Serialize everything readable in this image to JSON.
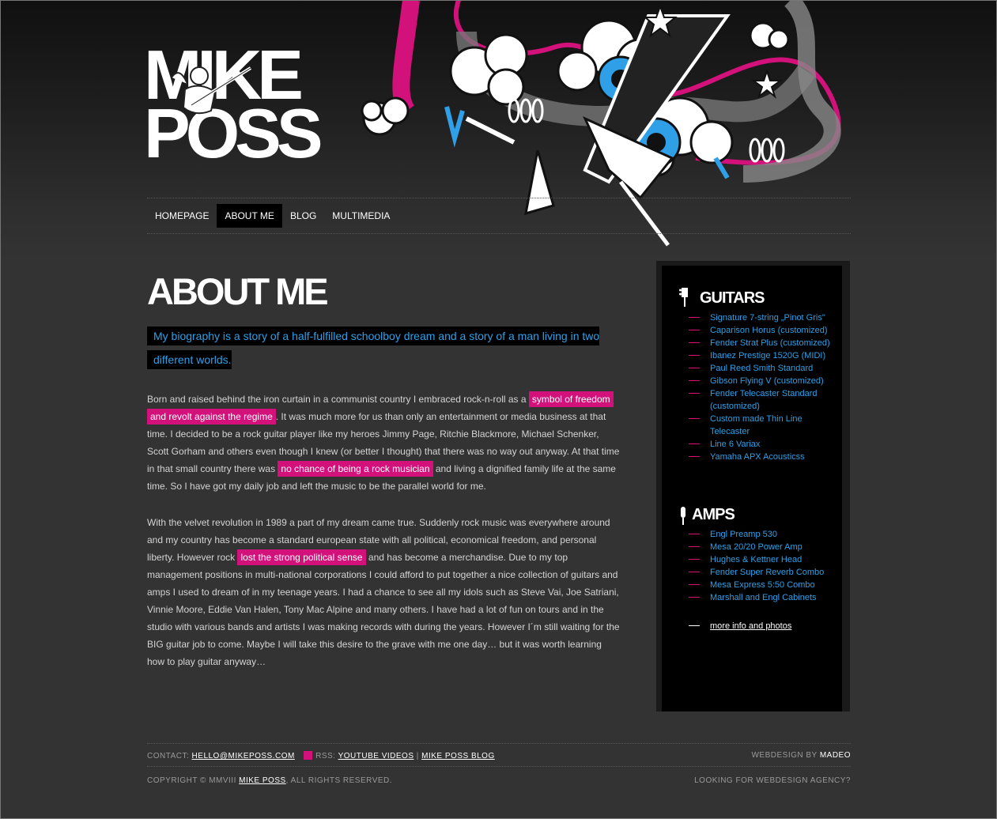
{
  "nav": {
    "items": [
      {
        "label": "HOMEPAGE"
      },
      {
        "label": "ABOUT ME"
      },
      {
        "label": "BLOG"
      },
      {
        "label": "MULTIMEDIA"
      }
    ]
  },
  "logo": {
    "line1": "MIKE",
    "line2": "POSS"
  },
  "main": {
    "title": "ABOUT ME",
    "intro": "My biography is a story of a half-fulfilled schoolboy dream and a story of a man living in two different worlds.",
    "p1": {
      "a": "Born and raised behind the iron curtain in a communist country I embraced rock-n-roll as a ",
      "h1": "symbol of freedom and revolt against the regime",
      "b": ". It was much more for us than only an entertainment or media business at that time. I decided to be a rock guitar player like my heroes Jimmy Page, Ritchie Blackmore, Michael Schenker, Scott Gorham and others even though I knew (or better I thought) that there was no way out anyway. At that time in that small country there was ",
      "h2": "no chance of being a rock musician",
      "c": " and living a dignified family life at the same time. So I have got my daily job and left the music to be the parallel world for me."
    },
    "p2": {
      "a": "With the velvet revolution in 1989 a part of my dream came true. Suddenly rock music was everywhere around and my country has become a standard european state with all political, economical freedom, and personal liberty. However rock ",
      "h1": "lost the strong political sense",
      "b": " and has become a merchandise. Due to my top management positions in multi-national corporations I could afford to put together a nice collection of guitars and amps I used to dream of in my teenage years. I had a chance to see all my idols such as Steve Vai, Joe Satriani, Vinnie Moore, Eddie Van Halen, Tony Mac Alpine and many others. I have had a lot of fun on tours and in the studio with various bands and artists I was making records with during the years. However I´m still waiting for the BIG guitar job to come. Maybe I will take this desire to the grave with me one day… but it was worth learning how to play guitar anyway…"
    }
  },
  "sidebar": {
    "guitars_title": "GUITARS",
    "guitars": [
      "Signature 7-string „Pinot Gris\"",
      "Caparison Horus (customized)",
      "Fender Strat Plus (customized)",
      "Ibanez Prestige 1520G (MIDI)",
      "Paul Reed Smith Standard",
      "Gibson Flying V (customized)",
      "Fender Telecaster Standard (customized)",
      "Custom made Thin Line Telecaster",
      "Line 6 Variax",
      "Yamaha APX Acousticss"
    ],
    "amps_title": "AMPS",
    "amps": [
      "Engl Preamp 530",
      "Mesa 20/20 Power Amp",
      "Hughes & Kettner Head",
      "Fender Super Reverb Combo",
      "Mesa Express 5:50 Combo",
      "Marshall and Engl Cabinets"
    ],
    "more": "more info and photos"
  },
  "footer": {
    "contact_label": "CONTACT:",
    "email": "HELLO@MIKEPOSS.COM",
    "rss_label": "RSS:",
    "youtube": "YOUTUBE VIDEOS",
    "sep": "|",
    "blog": "MIKE POSS BLOG",
    "webdesign_label": "WEBDESIGN BY",
    "webdesign_by": "MADEO",
    "copyright_a": "COPYRIGHT © MMVIII",
    "copyright_link": "MIKE POSS",
    "copyright_b": ", ALL RIGHTS RESERVED.",
    "agency": "LOOKING FOR WEBDESIGN AGENCY?"
  },
  "colors": {
    "accent_pink": "#d3117a",
    "accent_blue": "#2fa0e8",
    "background": "#333333"
  }
}
